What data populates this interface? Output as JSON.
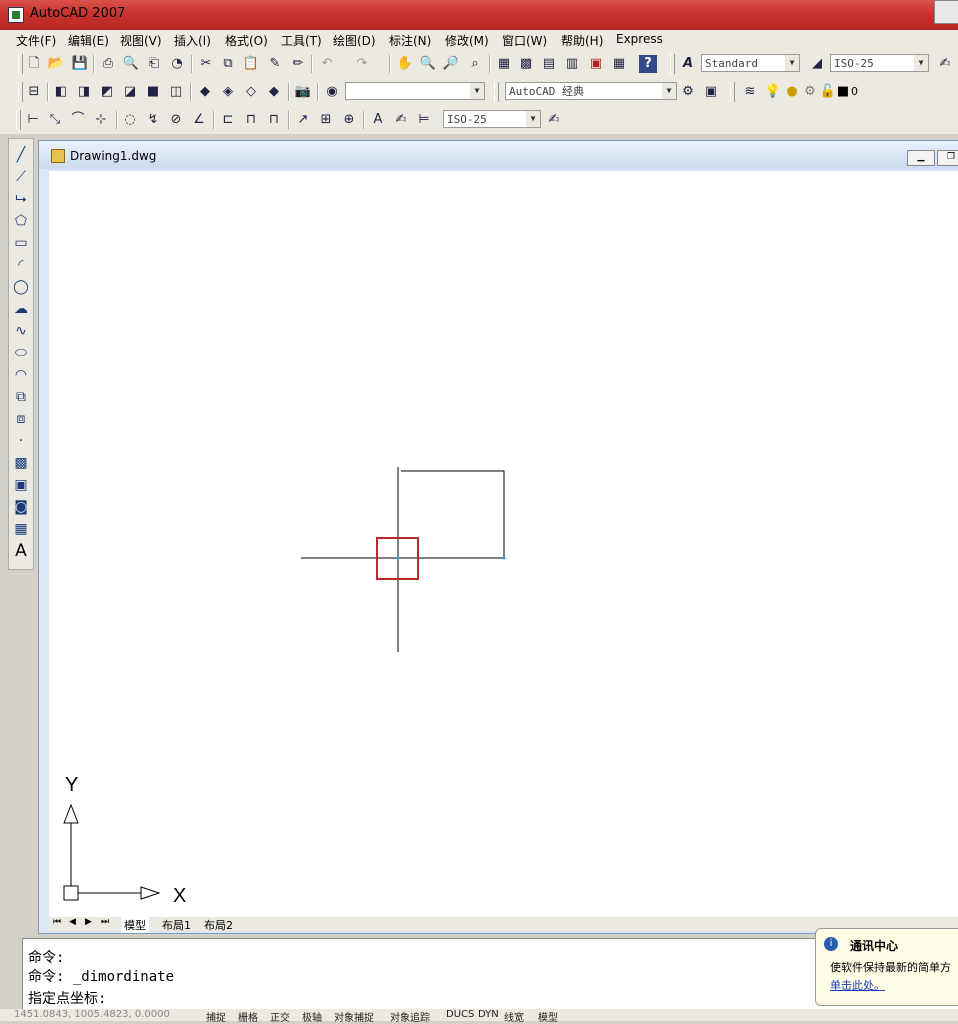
{
  "app_title": "AutoCAD 2007",
  "menu": [
    "文件(F)",
    "编辑(E)",
    "视图(V)",
    "插入(I)",
    "格式(O)",
    "工具(T)",
    "绘图(D)",
    "标注(N)",
    "修改(M)",
    "窗口(W)",
    "帮助(H)",
    "Express"
  ],
  "toolbar": {
    "text_style": "Standard",
    "dim_style": "ISO-25",
    "workspace": "AutoCAD 经典",
    "layer": "0",
    "dim_style2": "ISO-25"
  },
  "document": {
    "title": "Drawing1.dwg"
  },
  "ucs": {
    "x_label": "X",
    "y_label": "Y"
  },
  "layout_tabs": [
    "模型",
    "布局1",
    "布局2"
  ],
  "command_lines": [
    "命令:",
    "命令: _dimordinate",
    "指定点坐标:"
  ],
  "statusbar": {
    "coords": "1451.0843, 1005.4823, 0.0000",
    "toggles": [
      "捕捉",
      "栅格",
      "正交",
      "极轴",
      "对象捕捉",
      "对象追踪",
      "DUCS",
      "DYN",
      "线宽",
      "模型"
    ]
  },
  "balloon": {
    "title": "通讯中心",
    "text": "使软件保持最新的简单方",
    "link": "单击此处。"
  },
  "colors": {
    "title_bar": "#c8322d",
    "pickbox": "#c0272d",
    "menu_bg": "#ece9e0"
  }
}
